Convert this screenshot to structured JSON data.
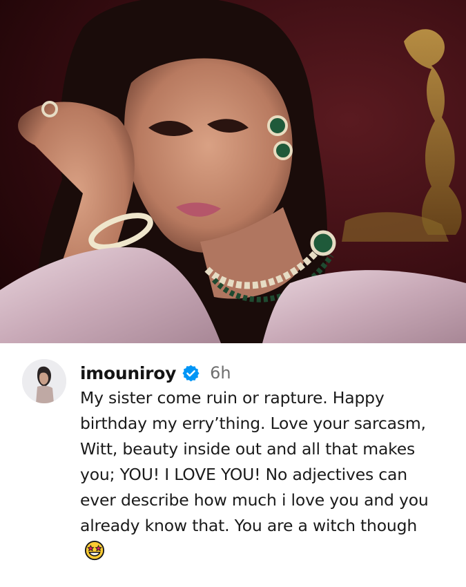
{
  "post": {
    "photo_alt": "Portrait photo",
    "background_color": "#3a0d12"
  },
  "comment": {
    "avatar_icon": "profile-avatar",
    "username": "imouniroy",
    "verified_icon": "verified-badge-icon",
    "verified_color": "#0095f6",
    "timestamp": "6h",
    "text": "My sister come ruin or rapture. Happy birthday my erry’thing. Love your sarcasm, Witt, beauty inside out and all that makes you; YOU! I LOVE YOU!  No adjectives can ever describe how much i love you and you already know that. You are a witch though",
    "emoji_icon": "star-struck-emoji"
  }
}
